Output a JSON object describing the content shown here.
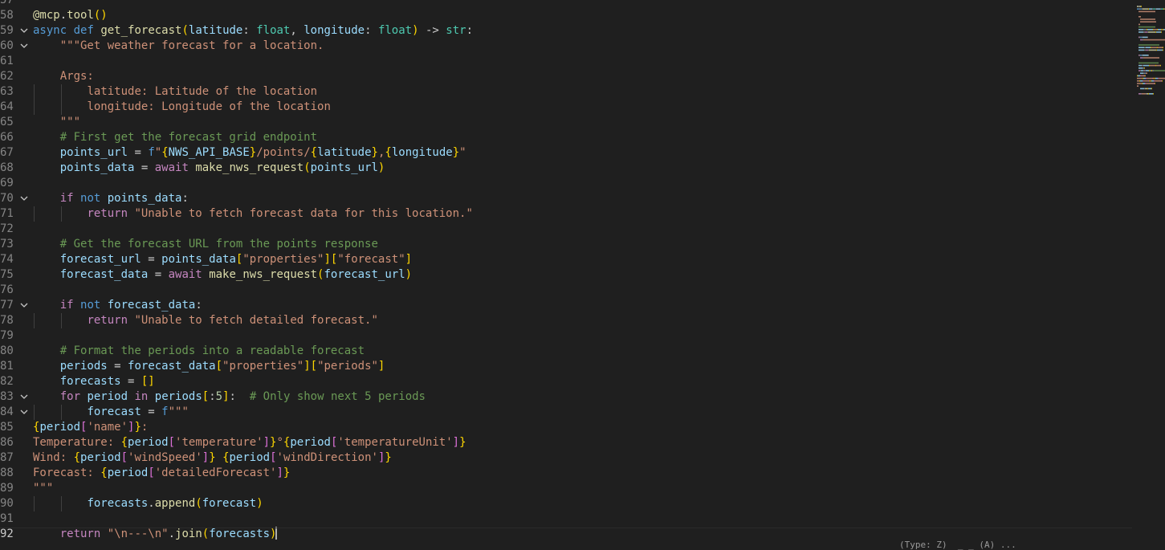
{
  "editor": {
    "language": "python",
    "lines": [
      {
        "num": "57",
        "fold": false,
        "indent": 0,
        "tokens": []
      },
      {
        "num": "58",
        "fold": false,
        "indent": 0,
        "tokens": [
          [
            "deco",
            "@mcp"
          ],
          [
            "txt",
            "."
          ],
          [
            "deco",
            "tool"
          ],
          [
            "b1",
            "()"
          ]
        ]
      },
      {
        "num": "59",
        "fold": true,
        "indent": 0,
        "tokens": [
          [
            "kw",
            "async"
          ],
          [
            "txt",
            " "
          ],
          [
            "kw",
            "def"
          ],
          [
            "txt",
            " "
          ],
          [
            "fn",
            "get_forecast"
          ],
          [
            "b1",
            "("
          ],
          [
            "var",
            "latitude"
          ],
          [
            "txt",
            ": "
          ],
          [
            "type",
            "float"
          ],
          [
            "txt",
            ", "
          ],
          [
            "var",
            "longitude"
          ],
          [
            "txt",
            ": "
          ],
          [
            "type",
            "float"
          ],
          [
            "b1",
            ")"
          ],
          [
            "txt",
            " -> "
          ],
          [
            "type",
            "str"
          ],
          [
            "txt",
            ":"
          ]
        ]
      },
      {
        "num": "60",
        "fold": true,
        "indent": 1,
        "tokens": [
          [
            "str",
            "\"\"\"Get weather forecast for a location."
          ]
        ]
      },
      {
        "num": "61",
        "fold": false,
        "indent": 0,
        "tokens": []
      },
      {
        "num": "62",
        "fold": false,
        "indent": 1,
        "tokens": [
          [
            "str",
            "Args:"
          ]
        ]
      },
      {
        "num": "63",
        "fold": false,
        "indent": 2,
        "tokens": [
          [
            "str",
            "latitude: Latitude of the location"
          ]
        ]
      },
      {
        "num": "64",
        "fold": false,
        "indent": 2,
        "tokens": [
          [
            "str",
            "longitude: Longitude of the location"
          ]
        ]
      },
      {
        "num": "65",
        "fold": false,
        "indent": 1,
        "tokens": [
          [
            "str",
            "\"\"\""
          ]
        ]
      },
      {
        "num": "66",
        "fold": false,
        "indent": 1,
        "tokens": [
          [
            "com",
            "# First get the forecast grid endpoint"
          ]
        ]
      },
      {
        "num": "67",
        "fold": false,
        "indent": 1,
        "tokens": [
          [
            "var",
            "points_url"
          ],
          [
            "txt",
            " = "
          ],
          [
            "kw",
            "f"
          ],
          [
            "str",
            "\""
          ],
          [
            "b1",
            "{"
          ],
          [
            "var",
            "NWS_API_BASE"
          ],
          [
            "b1",
            "}"
          ],
          [
            "str",
            "/points/"
          ],
          [
            "b1",
            "{"
          ],
          [
            "var",
            "latitude"
          ],
          [
            "b1",
            "}"
          ],
          [
            "str",
            ","
          ],
          [
            "b1",
            "{"
          ],
          [
            "var",
            "longitude"
          ],
          [
            "b1",
            "}"
          ],
          [
            "str",
            "\""
          ]
        ]
      },
      {
        "num": "68",
        "fold": false,
        "indent": 1,
        "tokens": [
          [
            "var",
            "points_data"
          ],
          [
            "txt",
            " = "
          ],
          [
            "ctrl",
            "await"
          ],
          [
            "txt",
            " "
          ],
          [
            "fn",
            "make_nws_request"
          ],
          [
            "b1",
            "("
          ],
          [
            "var",
            "points_url"
          ],
          [
            "b1",
            ")"
          ]
        ]
      },
      {
        "num": "69",
        "fold": false,
        "indent": 0,
        "tokens": []
      },
      {
        "num": "70",
        "fold": true,
        "indent": 1,
        "tokens": [
          [
            "ctrl",
            "if"
          ],
          [
            "txt",
            " "
          ],
          [
            "kw",
            "not"
          ],
          [
            "txt",
            " "
          ],
          [
            "var",
            "points_data"
          ],
          [
            "txt",
            ":"
          ]
        ]
      },
      {
        "num": "71",
        "fold": false,
        "indent": 2,
        "tokens": [
          [
            "ctrl",
            "return"
          ],
          [
            "txt",
            " "
          ],
          [
            "str",
            "\"Unable to fetch forecast data for this location.\""
          ]
        ]
      },
      {
        "num": "72",
        "fold": false,
        "indent": 0,
        "tokens": []
      },
      {
        "num": "73",
        "fold": false,
        "indent": 1,
        "tokens": [
          [
            "com",
            "# Get the forecast URL from the points response"
          ]
        ]
      },
      {
        "num": "74",
        "fold": false,
        "indent": 1,
        "tokens": [
          [
            "var",
            "forecast_url"
          ],
          [
            "txt",
            " = "
          ],
          [
            "var",
            "points_data"
          ],
          [
            "b1",
            "["
          ],
          [
            "str",
            "\"properties\""
          ],
          [
            "b1",
            "]["
          ],
          [
            "str",
            "\"forecast\""
          ],
          [
            "b1",
            "]"
          ]
        ]
      },
      {
        "num": "75",
        "fold": false,
        "indent": 1,
        "tokens": [
          [
            "var",
            "forecast_data"
          ],
          [
            "txt",
            " = "
          ],
          [
            "ctrl",
            "await"
          ],
          [
            "txt",
            " "
          ],
          [
            "fn",
            "make_nws_request"
          ],
          [
            "b1",
            "("
          ],
          [
            "var",
            "forecast_url"
          ],
          [
            "b1",
            ")"
          ]
        ]
      },
      {
        "num": "76",
        "fold": false,
        "indent": 0,
        "tokens": []
      },
      {
        "num": "77",
        "fold": true,
        "indent": 1,
        "tokens": [
          [
            "ctrl",
            "if"
          ],
          [
            "txt",
            " "
          ],
          [
            "kw",
            "not"
          ],
          [
            "txt",
            " "
          ],
          [
            "var",
            "forecast_data"
          ],
          [
            "txt",
            ":"
          ]
        ]
      },
      {
        "num": "78",
        "fold": false,
        "indent": 2,
        "tokens": [
          [
            "ctrl",
            "return"
          ],
          [
            "txt",
            " "
          ],
          [
            "str",
            "\"Unable to fetch detailed forecast.\""
          ]
        ]
      },
      {
        "num": "79",
        "fold": false,
        "indent": 0,
        "tokens": []
      },
      {
        "num": "80",
        "fold": false,
        "indent": 1,
        "tokens": [
          [
            "com",
            "# Format the periods into a readable forecast"
          ]
        ]
      },
      {
        "num": "81",
        "fold": false,
        "indent": 1,
        "tokens": [
          [
            "var",
            "periods"
          ],
          [
            "txt",
            " = "
          ],
          [
            "var",
            "forecast_data"
          ],
          [
            "b1",
            "["
          ],
          [
            "str",
            "\"properties\""
          ],
          [
            "b1",
            "]["
          ],
          [
            "str",
            "\"periods\""
          ],
          [
            "b1",
            "]"
          ]
        ]
      },
      {
        "num": "82",
        "fold": false,
        "indent": 1,
        "tokens": [
          [
            "var",
            "forecasts"
          ],
          [
            "txt",
            " = "
          ],
          [
            "b1",
            "[]"
          ]
        ]
      },
      {
        "num": "83",
        "fold": true,
        "indent": 1,
        "tokens": [
          [
            "ctrl",
            "for"
          ],
          [
            "txt",
            " "
          ],
          [
            "var",
            "period"
          ],
          [
            "txt",
            " "
          ],
          [
            "ctrl",
            "in"
          ],
          [
            "txt",
            " "
          ],
          [
            "var",
            "periods"
          ],
          [
            "b1",
            "["
          ],
          [
            "txt",
            ":"
          ],
          [
            "num",
            "5"
          ],
          [
            "b1",
            "]"
          ],
          [
            "txt",
            ":  "
          ],
          [
            "com",
            "# Only show next 5 periods"
          ]
        ]
      },
      {
        "num": "84",
        "fold": true,
        "indent": 2,
        "tokens": [
          [
            "var",
            "forecast"
          ],
          [
            "txt",
            " = "
          ],
          [
            "kw",
            "f"
          ],
          [
            "str",
            "\"\"\""
          ]
        ]
      },
      {
        "num": "85",
        "fold": false,
        "indent": 0,
        "tokens": [
          [
            "b1",
            "{"
          ],
          [
            "var",
            "period"
          ],
          [
            "b2",
            "["
          ],
          [
            "str",
            "'name'"
          ],
          [
            "b2",
            "]"
          ],
          [
            "b1",
            "}"
          ],
          [
            "str",
            ":"
          ]
        ]
      },
      {
        "num": "86",
        "fold": false,
        "indent": 0,
        "tokens": [
          [
            "str",
            "Temperature: "
          ],
          [
            "b1",
            "{"
          ],
          [
            "var",
            "period"
          ],
          [
            "b2",
            "["
          ],
          [
            "str",
            "'temperature'"
          ],
          [
            "b2",
            "]"
          ],
          [
            "b1",
            "}"
          ],
          [
            "str",
            "°"
          ],
          [
            "b1",
            "{"
          ],
          [
            "var",
            "period"
          ],
          [
            "b2",
            "["
          ],
          [
            "str",
            "'temperatureUnit'"
          ],
          [
            "b2",
            "]"
          ],
          [
            "b1",
            "}"
          ]
        ]
      },
      {
        "num": "87",
        "fold": false,
        "indent": 0,
        "tokens": [
          [
            "str",
            "Wind: "
          ],
          [
            "b1",
            "{"
          ],
          [
            "var",
            "period"
          ],
          [
            "b2",
            "["
          ],
          [
            "str",
            "'windSpeed'"
          ],
          [
            "b2",
            "]"
          ],
          [
            "b1",
            "}"
          ],
          [
            "str",
            " "
          ],
          [
            "b1",
            "{"
          ],
          [
            "var",
            "period"
          ],
          [
            "b2",
            "["
          ],
          [
            "str",
            "'windDirection'"
          ],
          [
            "b2",
            "]"
          ],
          [
            "b1",
            "}"
          ]
        ]
      },
      {
        "num": "88",
        "fold": false,
        "indent": 0,
        "tokens": [
          [
            "str",
            "Forecast: "
          ],
          [
            "b1",
            "{"
          ],
          [
            "var",
            "period"
          ],
          [
            "b2",
            "["
          ],
          [
            "str",
            "'detailedForecast'"
          ],
          [
            "b2",
            "]"
          ],
          [
            "b1",
            "}"
          ]
        ]
      },
      {
        "num": "89",
        "fold": false,
        "indent": 0,
        "tokens": [
          [
            "str",
            "\"\"\""
          ]
        ]
      },
      {
        "num": "90",
        "fold": false,
        "indent": 2,
        "tokens": [
          [
            "var",
            "forecasts"
          ],
          [
            "txt",
            "."
          ],
          [
            "fn",
            "append"
          ],
          [
            "b1",
            "("
          ],
          [
            "var",
            "forecast"
          ],
          [
            "b1",
            ")"
          ]
        ]
      },
      {
        "num": "91",
        "fold": false,
        "indent": 0,
        "tokens": []
      },
      {
        "num": "92",
        "fold": false,
        "indent": 1,
        "current": true,
        "tokens": [
          [
            "ctrl",
            "return"
          ],
          [
            "txt",
            " "
          ],
          [
            "str",
            "\"\\n---\\n\""
          ],
          [
            "txt",
            "."
          ],
          [
            "fn",
            "join"
          ],
          [
            "b1",
            "("
          ],
          [
            "var",
            "forecasts"
          ],
          [
            "b1",
            ")"
          ]
        ]
      }
    ]
  },
  "peek_text": "(Type: Z)  _ _ (A) ...",
  "colors": {
    "background": "#1f1f1f",
    "line_number": "#858585",
    "keyword": "#569cd6",
    "control": "#c586c0",
    "string": "#ce9178",
    "comment": "#6a9955",
    "function": "#dcdcaa",
    "variable": "#9cdcfe",
    "type": "#4ec9b0",
    "bracket_gold": "#ffd700",
    "bracket_purple": "#da70d6"
  },
  "icons": {
    "fold": "chevron-down-icon"
  }
}
